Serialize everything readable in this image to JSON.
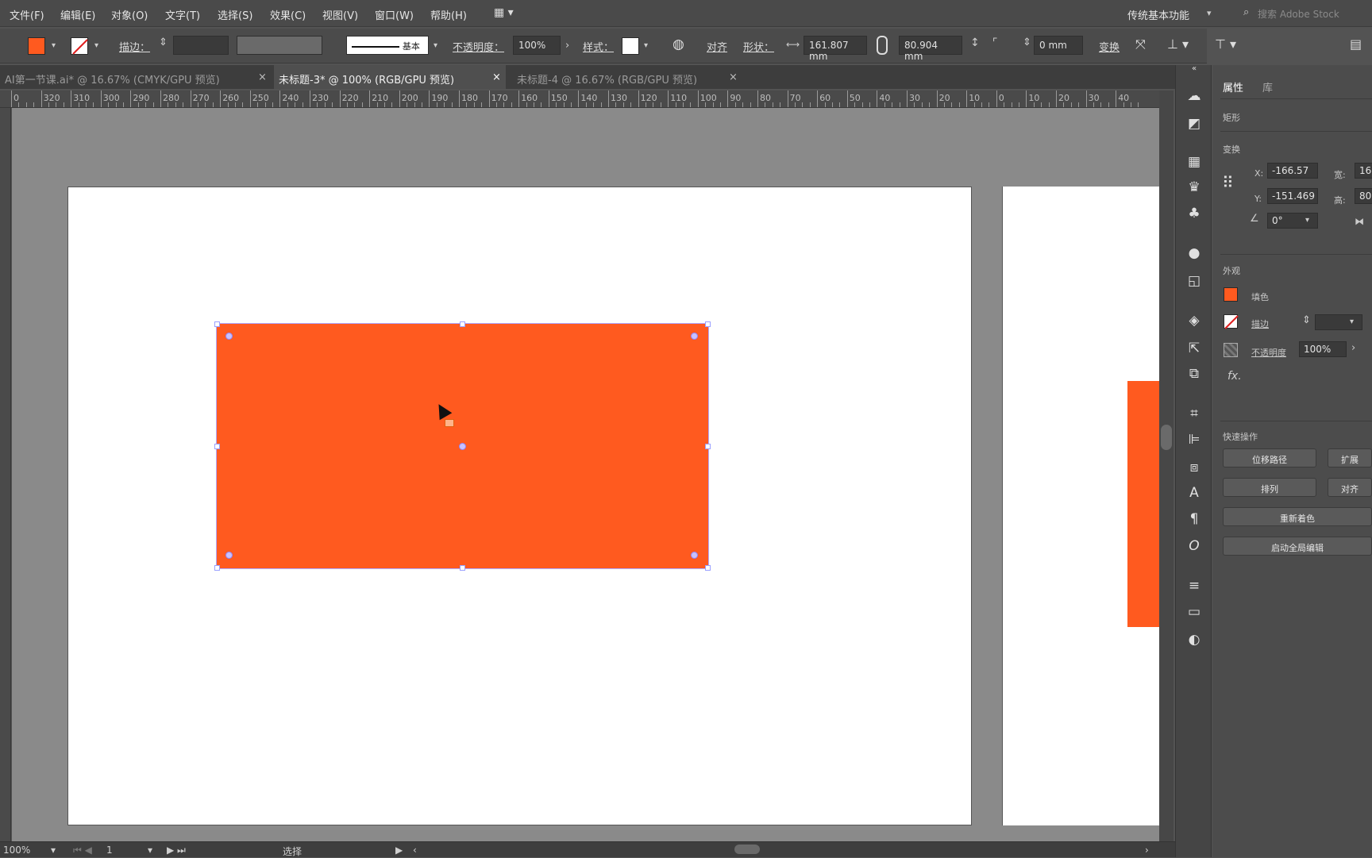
{
  "menu": {
    "items": [
      "文件(F)",
      "编辑(E)",
      "对象(O)",
      "文字(T)",
      "选择(S)",
      "效果(C)",
      "视图(V)",
      "窗口(W)",
      "帮助(H)"
    ],
    "workspace": "传统基本功能",
    "search_placeholder": "搜索 Adobe Stock"
  },
  "control": {
    "fill_color": "#ff5a1f",
    "stroke_label": "描边：",
    "stroke_style": "基本",
    "opacity_label": "不透明度：",
    "opacity_value": "100%",
    "style_label": "样式：",
    "align_label": "对齐",
    "shape_label": "形状：",
    "width_value": "161.807 mm",
    "height_value": "80.904 mm",
    "corner_value": "0 mm",
    "transform_label": "变换"
  },
  "tabs": [
    {
      "label": "AI第一节课.ai* @ 16.67% (CMYK/GPU 预览)",
      "active": false
    },
    {
      "label": "未标题-3* @ 100% (RGB/GPU 预览)",
      "active": true
    },
    {
      "label": "未标题-4 @ 16.67% (RGB/GPU 预览)",
      "active": false
    }
  ],
  "ruler": {
    "labels": [
      "0",
      "320",
      "310",
      "300",
      "290",
      "280",
      "270",
      "260",
      "250",
      "240",
      "230",
      "220",
      "210",
      "200",
      "190",
      "180",
      "170",
      "160",
      "150",
      "140",
      "130",
      "120",
      "110",
      "100",
      "90",
      "80",
      "70",
      "60",
      "50",
      "40",
      "30",
      "20",
      "10",
      "0",
      "10",
      "20",
      "30",
      "40"
    ]
  },
  "status": {
    "zoom": "100%",
    "page": "1",
    "tool": "选择"
  },
  "panel": {
    "tabs": [
      "属性",
      "库"
    ],
    "shape_type": "矩形",
    "transform_header": "变换",
    "x_label": "X:",
    "x_value": "-166.57",
    "y_label": "Y:",
    "y_value": "-151.469",
    "w_label": "宽:",
    "w_value": "16",
    "h_label": "高:",
    "h_value": "80",
    "angle_value": "0°",
    "appearance_header": "外观",
    "fill_label": "填色",
    "stroke_label": "描边",
    "opacity_label": "不透明度",
    "opacity_value": "100%",
    "fx_label": "fx.",
    "quick_actions_header": "快速操作",
    "btn_offset_path": "位移路径",
    "btn_expand": "扩展",
    "btn_arrange": "排列",
    "btn_align": "对齐",
    "btn_recolor": "重新着色",
    "btn_global_edit": "启动全局编辑"
  }
}
